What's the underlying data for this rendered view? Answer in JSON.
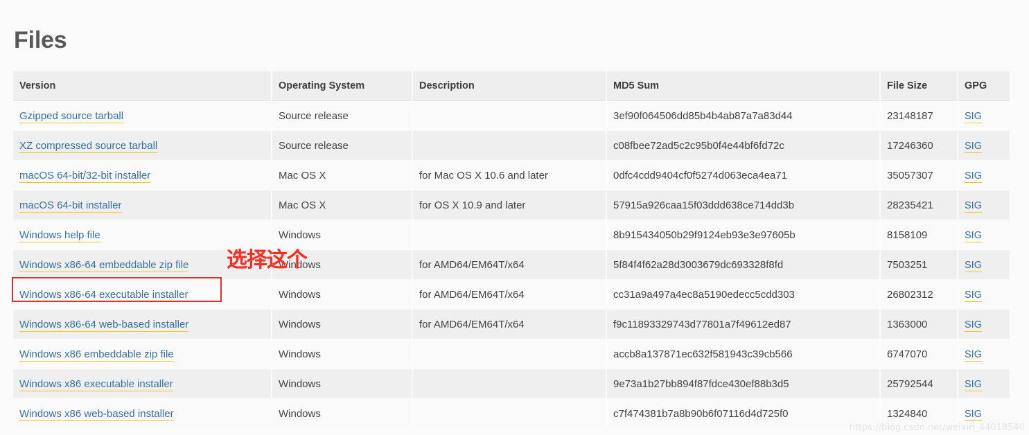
{
  "page": {
    "title": "Files",
    "watermark": "https://blog.csdn.net/weixin_44018540"
  },
  "annotation": {
    "text": "选择这个",
    "color": "#fb2c20",
    "box_color": "#e8302a",
    "target_row_index": 6
  },
  "colors": {
    "link": "#3771a1",
    "link_underline": "#f5c518",
    "header_bg": "#eeeeee",
    "row_odd_bg": "#fafafa",
    "row_even_bg": "#efefef",
    "page_bg": "#fbfbfb",
    "title": "#585858"
  },
  "table": {
    "columns": [
      {
        "key": "version",
        "label": "Version"
      },
      {
        "key": "os",
        "label": "Operating System"
      },
      {
        "key": "description",
        "label": "Description"
      },
      {
        "key": "md5",
        "label": "MD5 Sum"
      },
      {
        "key": "size",
        "label": "File Size"
      },
      {
        "key": "gpg",
        "label": "GPG"
      }
    ],
    "rows": [
      {
        "version": "Gzipped source tarball",
        "os": "Source release",
        "description": "",
        "md5": "3ef90f064506dd85b4b4ab87a7a83d44",
        "size": "23148187",
        "gpg": "SIG"
      },
      {
        "version": "XZ compressed source tarball",
        "os": "Source release",
        "description": "",
        "md5": "c08fbee72ad5c2c95b0f4e44bf6fd72c",
        "size": "17246360",
        "gpg": "SIG"
      },
      {
        "version": "macOS 64-bit/32-bit installer",
        "os": "Mac OS X",
        "description": "for Mac OS X 10.6 and later",
        "md5": "0dfc4cdd9404cf0f5274d063eca4ea71",
        "size": "35057307",
        "gpg": "SIG"
      },
      {
        "version": "macOS 64-bit installer",
        "os": "Mac OS X",
        "description": "for OS X 10.9 and later",
        "md5": "57915a926caa15f03ddd638ce714dd3b",
        "size": "28235421",
        "gpg": "SIG"
      },
      {
        "version": "Windows help file",
        "os": "Windows",
        "description": "",
        "md5": "8b915434050b29f9124eb93e3e97605b",
        "size": "8158109",
        "gpg": "SIG"
      },
      {
        "version": "Windows x86-64 embeddable zip file",
        "os": "Windows",
        "description": "for AMD64/EM64T/x64",
        "md5": "5f84f4f62a28d3003679dc693328f8fd",
        "size": "7503251",
        "gpg": "SIG"
      },
      {
        "version": "Windows x86-64 executable installer",
        "os": "Windows",
        "description": "for AMD64/EM64T/x64",
        "md5": "cc31a9a497a4ec8a5190edecc5cdd303",
        "size": "26802312",
        "gpg": "SIG"
      },
      {
        "version": "Windows x86-64 web-based installer",
        "os": "Windows",
        "description": "for AMD64/EM64T/x64",
        "md5": "f9c11893329743d77801a7f49612ed87",
        "size": "1363000",
        "gpg": "SIG"
      },
      {
        "version": "Windows x86 embeddable zip file",
        "os": "Windows",
        "description": "",
        "md5": "accb8a137871ec632f581943c39cb566",
        "size": "6747070",
        "gpg": "SIG"
      },
      {
        "version": "Windows x86 executable installer",
        "os": "Windows",
        "description": "",
        "md5": "9e73a1b27bb894f87fdce430ef88b3d5",
        "size": "25792544",
        "gpg": "SIG"
      },
      {
        "version": "Windows x86 web-based installer",
        "os": "Windows",
        "description": "",
        "md5": "c7f474381b7a8b90b6f07116d4d725f0",
        "size": "1324840",
        "gpg": "SIG"
      }
    ]
  }
}
